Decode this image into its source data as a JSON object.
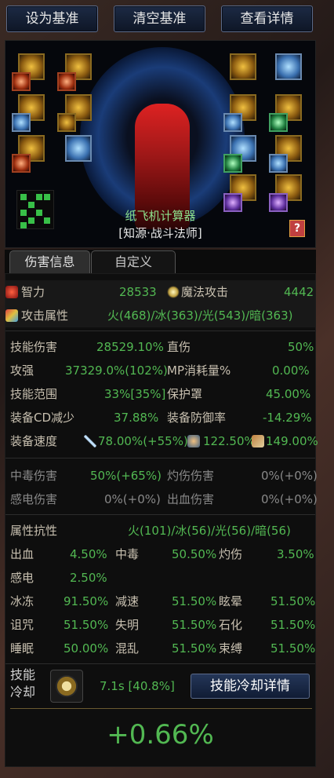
{
  "toolbar": {
    "set_baseline": "设为基准",
    "clear_baseline": "清空基准",
    "view_details": "查看详情"
  },
  "character": {
    "calculator_name": "纸飞机计算器",
    "title": "[知源·战斗法师]",
    "book_icon": "?"
  },
  "tabs": {
    "damage_info": "伤害信息",
    "custom": "自定义"
  },
  "stats": {
    "intelligence": {
      "label": "智力",
      "value": "28533"
    },
    "magic_attack": {
      "label": "魔法攻击",
      "value": "4442"
    },
    "attack_element": {
      "label": "攻击属性",
      "value": "火(468)/冰(363)/光(543)/暗(363)"
    },
    "skill_damage": {
      "label": "技能伤害",
      "value": "28529.10%"
    },
    "direct_damage": {
      "label": "直伤",
      "value": "50%"
    },
    "attack_strength": {
      "label": "攻强",
      "value": "37329.0%(102%)"
    },
    "mp_cost": {
      "label": "MP消耗量%",
      "value": "0.00%"
    },
    "skill_range": {
      "label": "技能范围",
      "value": "33%[35%]"
    },
    "shield": {
      "label": "保护罩",
      "value": "45.00%"
    },
    "cd_reduction": {
      "label": "装备CD减少",
      "value": "37.88%"
    },
    "defense_rate": {
      "label": "装备防御率",
      "value": "-14.29%"
    },
    "speed": {
      "label": "装备速度",
      "atk": "78.00%(+55%)",
      "cast": "122.50%",
      "move": "149.00%"
    },
    "poison_dmg": {
      "label": "中毒伤害",
      "value": "50%(+65%)"
    },
    "burn_dmg": {
      "label": "灼伤伤害",
      "value": "0%(+0%)"
    },
    "shock_dmg": {
      "label": "感电伤害",
      "value": "0%(+0%)"
    },
    "bleed_dmg": {
      "label": "出血伤害",
      "value": "0%(+0%)"
    },
    "element_resist": {
      "label": "属性抗性",
      "value": "火(101)/冰(56)/光(56)/暗(56)"
    },
    "bleed": {
      "label": "出血",
      "value": "4.50%"
    },
    "poison": {
      "label": "中毒",
      "value": "50.50%"
    },
    "burn": {
      "label": "灼伤",
      "value": "3.50%"
    },
    "shock": {
      "label": "感电",
      "value": "2.50%"
    },
    "freeze": {
      "label": "冰冻",
      "value": "91.50%"
    },
    "slow": {
      "label": "减速",
      "value": "51.50%"
    },
    "stun": {
      "label": "眩晕",
      "value": "51.50%"
    },
    "curse": {
      "label": "诅咒",
      "value": "51.50%"
    },
    "blind": {
      "label": "失明",
      "value": "51.50%"
    },
    "stone": {
      "label": "石化",
      "value": "51.50%"
    },
    "sleep": {
      "label": "睡眠",
      "value": "50.00%"
    },
    "confuse": {
      "label": "混乱",
      "value": "51.50%"
    },
    "bind": {
      "label": "束缚",
      "value": "51.50%"
    }
  },
  "skill_cd": {
    "label_line1": "技能",
    "label_line2": "冷却",
    "value": "7.1s [40.8%]",
    "details_button": "技能冷却详情"
  },
  "result": "+0.66%"
}
